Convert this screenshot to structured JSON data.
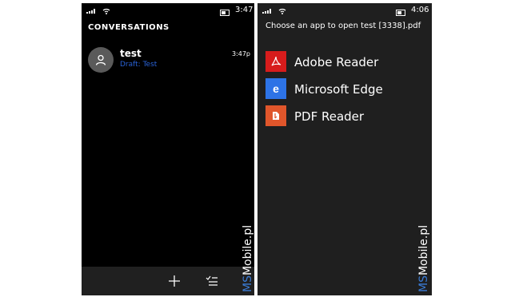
{
  "left": {
    "status_time": "3:47",
    "title": "CONVERSATIONS",
    "conversation": {
      "name": "test",
      "draft": "Draft: Test",
      "time": "3:47p"
    },
    "watermark": {
      "ms": "MS",
      "rest": "Mobile.pl"
    }
  },
  "right": {
    "status_time": "4:06",
    "title": "Choose an app to open test [3338].pdf",
    "apps": [
      {
        "label": "Adobe Reader",
        "color": "#d71c1c"
      },
      {
        "label": "Microsoft Edge",
        "color": "#2d73e6"
      },
      {
        "label": "PDF Reader",
        "color": "#e0562b"
      }
    ],
    "watermark": {
      "ms": "MS",
      "rest": "Mobile.pl"
    }
  }
}
